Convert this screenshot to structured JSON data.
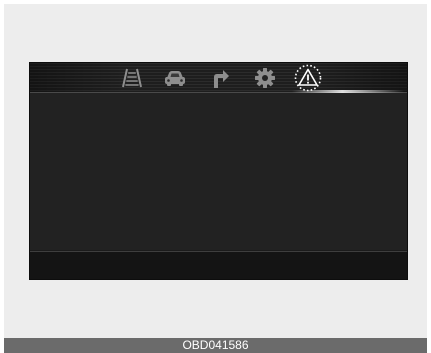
{
  "menu": {
    "items": [
      {
        "icon": "lane-road-icon",
        "selected": false
      },
      {
        "icon": "car-icon",
        "selected": false
      },
      {
        "icon": "turn-arrow-icon",
        "selected": false
      },
      {
        "icon": "gear-icon",
        "selected": false
      },
      {
        "icon": "warning-triangle-icon",
        "selected": true
      }
    ],
    "highlight_color": "#ffffff"
  },
  "colors": {
    "display_background": "#222222",
    "icon": "#8e8e8e",
    "selected_icon": "#ffffff",
    "caption_background": "#6b6b6b"
  },
  "caption": {
    "text": "OBD041586"
  }
}
